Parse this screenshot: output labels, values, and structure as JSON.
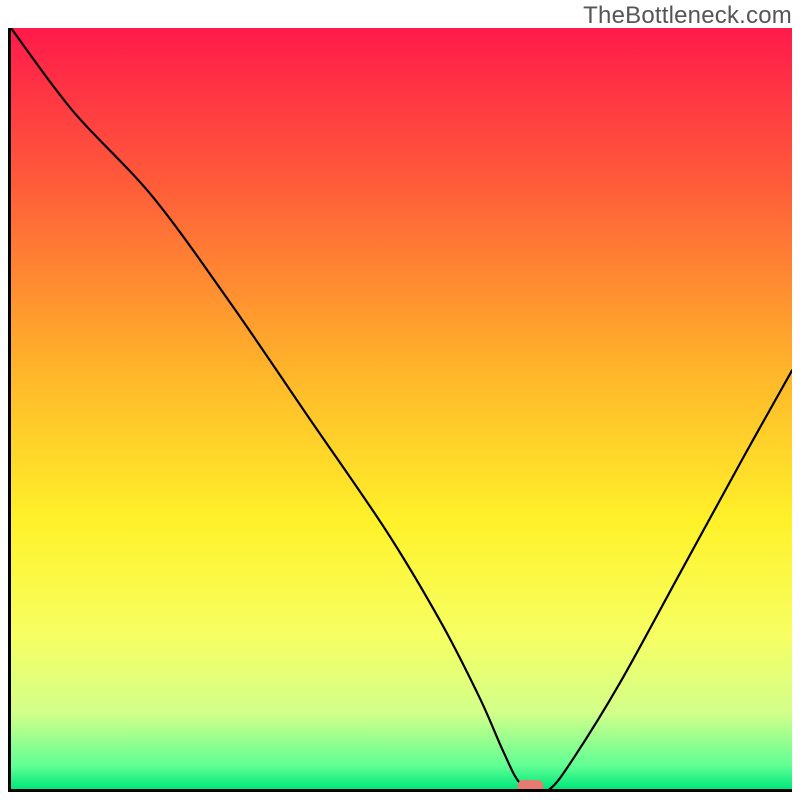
{
  "watermark": "TheBottleneck.com",
  "chart_data": {
    "type": "line",
    "title": "",
    "xlabel": "",
    "ylabel": "",
    "xlim": [
      0,
      100
    ],
    "ylim": [
      0,
      100
    ],
    "grid": false,
    "legend": false,
    "background_gradient": {
      "stops": [
        {
          "offset": 0.0,
          "color": "#ff1a4b"
        },
        {
          "offset": 0.2,
          "color": "#ff5a3a"
        },
        {
          "offset": 0.45,
          "color": "#ffb52a"
        },
        {
          "offset": 0.65,
          "color": "#fff22a"
        },
        {
          "offset": 0.8,
          "color": "#f6ff63"
        },
        {
          "offset": 0.9,
          "color": "#d2ff8a"
        },
        {
          "offset": 0.97,
          "color": "#5fff94"
        },
        {
          "offset": 1.0,
          "color": "#00e67a"
        }
      ]
    },
    "series": [
      {
        "name": "bottleneck-curve",
        "x": [
          0,
          8,
          18,
          28,
          38,
          48,
          55,
          60,
          63,
          65,
          67,
          69,
          72,
          78,
          86,
          94,
          100
        ],
        "y": [
          100,
          89,
          78,
          64,
          49,
          34,
          22,
          12,
          5,
          1,
          0,
          0,
          4,
          14,
          29,
          44,
          55
        ]
      }
    ],
    "marker": {
      "x": 66.5,
      "y": 0,
      "color": "#e77b72"
    }
  }
}
